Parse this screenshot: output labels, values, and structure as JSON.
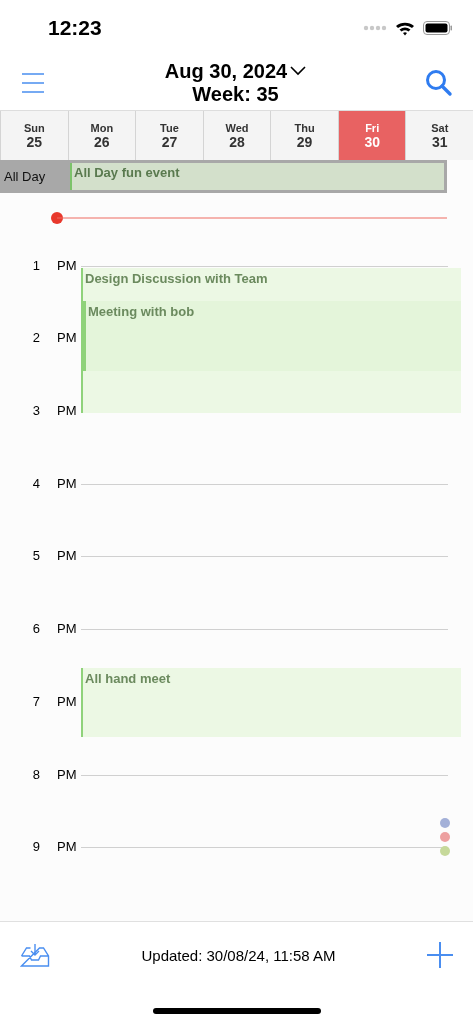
{
  "status_bar": {
    "time": "12:23"
  },
  "header": {
    "date": "Aug 30, 2024",
    "week": "Week: 35"
  },
  "days": [
    {
      "name": "Sun",
      "number": "25",
      "selected": false
    },
    {
      "name": "Mon",
      "number": "26",
      "selected": false
    },
    {
      "name": "Tue",
      "number": "27",
      "selected": false
    },
    {
      "name": "Wed",
      "number": "28",
      "selected": false
    },
    {
      "name": "Thu",
      "number": "29",
      "selected": false
    },
    {
      "name": "Fri",
      "number": "30",
      "selected": true
    },
    {
      "name": "Sat",
      "number": "31",
      "selected": false
    }
  ],
  "all_day": {
    "label": "All Day",
    "events": [
      {
        "title": "All Day fun event"
      }
    ]
  },
  "hours": [
    {
      "hour": "1",
      "period": "PM",
      "events": [
        {
          "title": "Design Discussion with Team",
          "half_past": false,
          "kind": "long",
          "children": [
            {
              "title": "Meeting with bob",
              "half_past": true,
              "kind": "short"
            }
          ]
        }
      ]
    },
    {
      "hour": "2",
      "period": "PM"
    },
    {
      "hour": "3",
      "period": "PM"
    },
    {
      "hour": "4",
      "period": "PM"
    },
    {
      "hour": "5",
      "period": "PM"
    },
    {
      "hour": "6",
      "period": "PM",
      "events": [
        {
          "title": "All hand meet",
          "half_past": true,
          "kind": "short"
        }
      ]
    },
    {
      "hour": "7",
      "period": "PM"
    },
    {
      "hour": "8",
      "period": "PM"
    },
    {
      "hour": "9",
      "period": "PM"
    }
  ],
  "indicator_dots": [
    {
      "color": "#a3b0d8"
    },
    {
      "color": "#eda0a0"
    },
    {
      "color": "#c6d99a"
    }
  ],
  "footer": {
    "updated": "Updated: 30/08/24, 11:58 AM"
  }
}
